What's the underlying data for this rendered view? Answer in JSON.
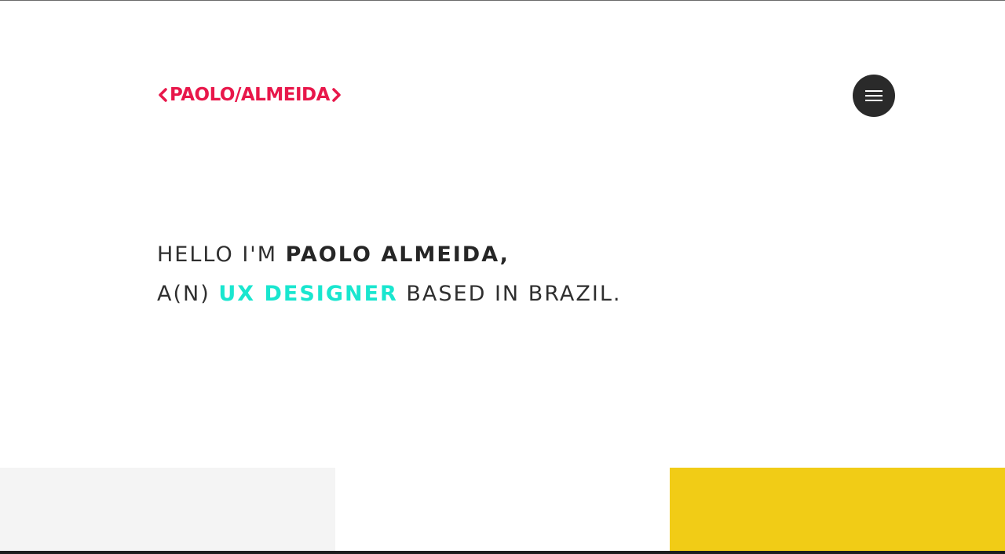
{
  "header": {
    "logo_text": "PAOLO/ALMEIDA",
    "logo_color": "#e8174a",
    "menu_icon": "hamburger-menu-icon"
  },
  "hero": {
    "line1_prefix": "HELLO I'M ",
    "line1_name": "PAOLO ALMEIDA,",
    "line2_prefix": "A(N) ",
    "line2_role": "UX DESIGNER",
    "line2_suffix": " BASED IN BRAZIL.",
    "accent_color": "#19e6cf"
  },
  "panels": [
    {
      "color": "#f4f4f4"
    },
    {
      "color": "#ffffff"
    },
    {
      "color": "#f1cc16"
    }
  ]
}
